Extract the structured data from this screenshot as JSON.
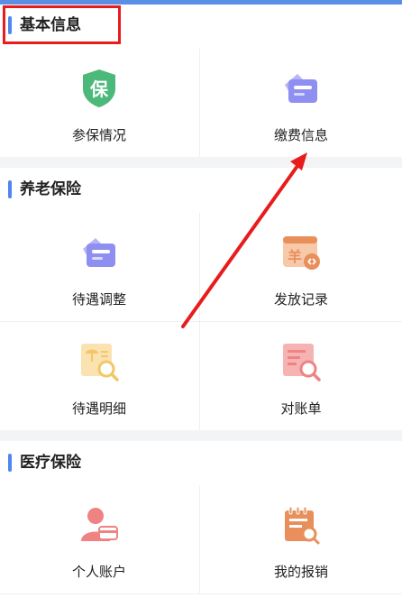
{
  "colors": {
    "accent": "#4f86f1",
    "annotation": "#e81c1c",
    "green": "#4cb87a",
    "purple": "#8f8ff2",
    "orange": "#e88f5c",
    "yellow": "#f2c767",
    "red": "#ef8383"
  },
  "sections": [
    {
      "title": "基本信息",
      "items": [
        {
          "label": "参保情况",
          "icon": "shield-bao-icon"
        },
        {
          "label": "缴费信息",
          "icon": "card-icon"
        }
      ]
    },
    {
      "title": "养老保险",
      "items": [
        {
          "label": "待遇调整",
          "icon": "card-icon"
        },
        {
          "label": "发放记录",
          "icon": "yuan-receipt-icon"
        },
        {
          "label": "待遇明细",
          "icon": "umbrella-search-icon"
        },
        {
          "label": "对账单",
          "icon": "statement-search-icon"
        }
      ]
    },
    {
      "title": "医疗保险",
      "items": [
        {
          "label": "个人账户",
          "icon": "user-card-icon"
        },
        {
          "label": "我的报销",
          "icon": "notepad-search-icon"
        }
      ]
    }
  ],
  "shield_glyph": "保",
  "yuan_glyph": "羊"
}
